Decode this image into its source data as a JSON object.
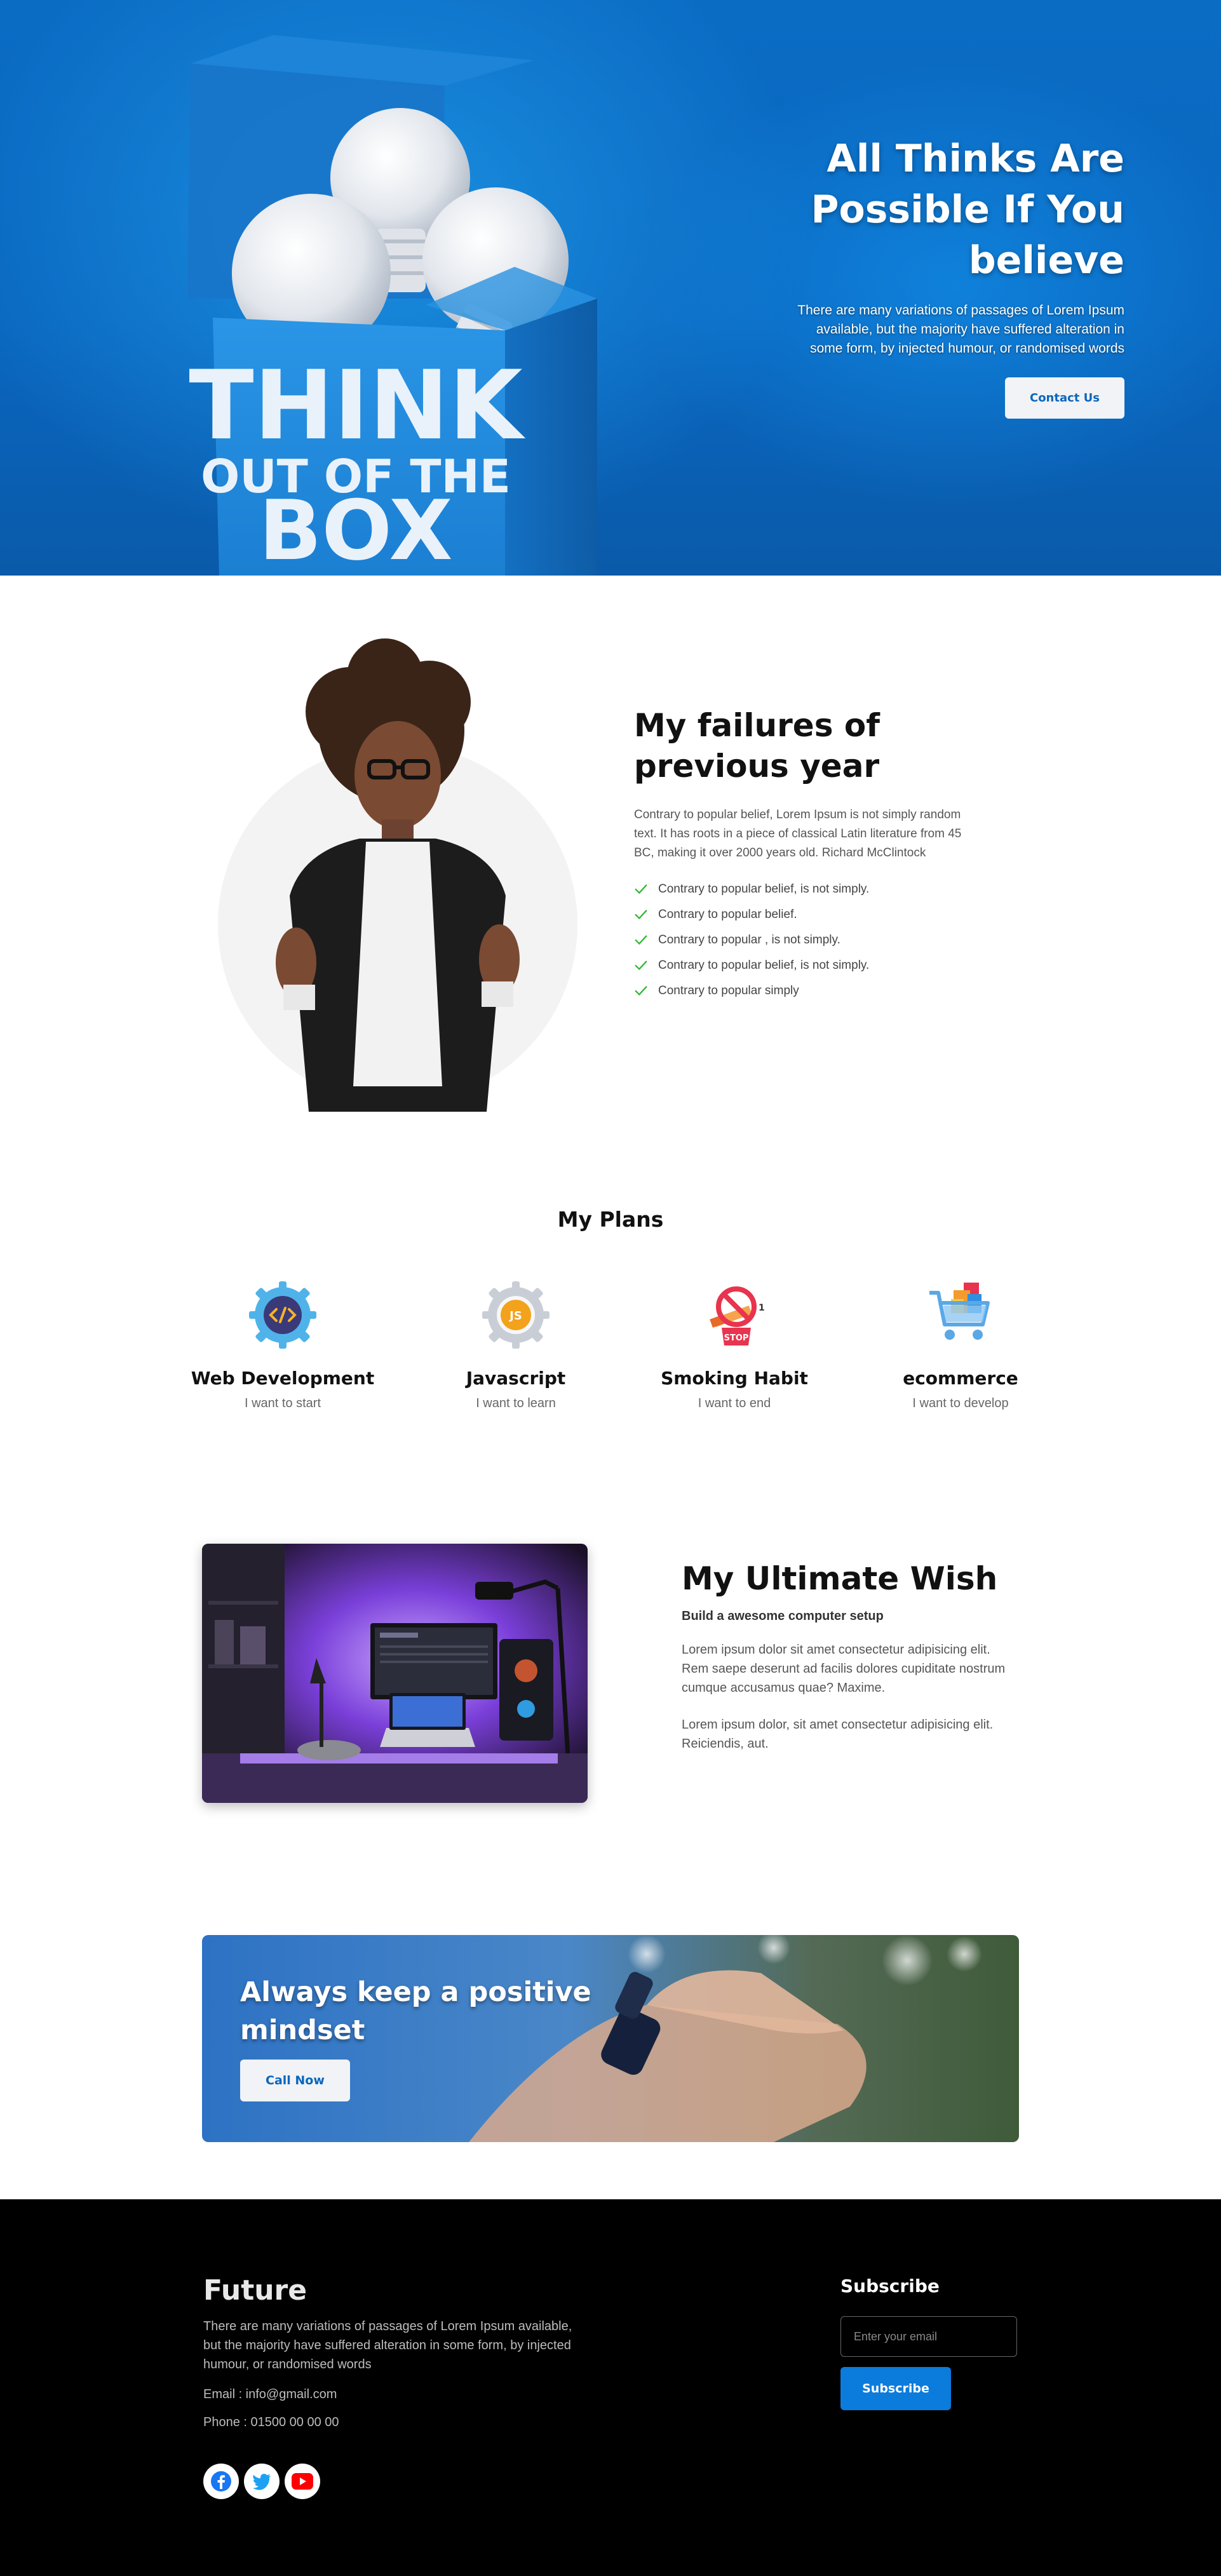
{
  "hero": {
    "title": "All Thinks Are Possible If You believe",
    "text": "There are many variations of passages of Lorem Ipsum available, but the majority have suffered alteration in some form, by injected humour, or randomised words",
    "button": "Contact Us",
    "box_lines": [
      "THINK",
      "OUT OF THE",
      "BOX"
    ]
  },
  "failures": {
    "title": "My failures of previous year",
    "text": "Contrary to popular belief, Lorem Ipsum is not simply random text. It has roots in a piece of classical Latin literature from 45 BC, making it over 2000 years old. Richard McClintock",
    "items": [
      "Contrary to popular belief, is not simply.",
      "Contrary to popular belief.",
      "Contrary to popular , is not simply.",
      "Contrary to popular belief, is not simply.",
      "Contrary to popular simply"
    ]
  },
  "plans": {
    "title": "My Plans",
    "items": [
      {
        "name": "Web Development",
        "sub": "I want to start",
        "icon": "code-gear-icon"
      },
      {
        "name": "Javascript",
        "sub": "I want to learn",
        "icon": "js-gear-icon"
      },
      {
        "name": "Smoking Habit",
        "sub": "I want to end",
        "icon": "no-smoking-icon",
        "badge": "STOP"
      },
      {
        "name": "ecommerce",
        "sub": "I want to develop",
        "icon": "shopping-cart-icon"
      }
    ]
  },
  "wish": {
    "title": "My Ultimate Wish",
    "subtitle": "Build a awesome computer setup",
    "p1": "Lorem ipsum dolor sit amet consectetur adipisicing elit. Rem saepe deserunt ad facilis dolores cupiditate nostrum cumque accusamus quae? Maxime.",
    "p2": "Lorem ipsum dolor, sit amet consectetur adipisicing elit. Reiciendis, aut."
  },
  "banner": {
    "title": "Always keep a positive mindset",
    "button": "Call Now"
  },
  "footer": {
    "brand": "Future",
    "text": "There are many variations of passages of Lorem Ipsum available, but the majority have suffered alteration in some form, by injected humour, or randomised words",
    "email": "Email : info@gmail.com",
    "phone": "Phone : 01500 00 00 00",
    "subscribe_title": "Subscribe",
    "email_placeholder": "Enter your email",
    "subscribe_button": "Subscribe",
    "socials": [
      "facebook-icon",
      "twitter-icon",
      "youtube-icon"
    ]
  },
  "colors": {
    "hero_blue": "#0b6cc4",
    "accent": "#0b7bdc",
    "check_green": "#2eb82e",
    "footer_bg": "#000000"
  }
}
